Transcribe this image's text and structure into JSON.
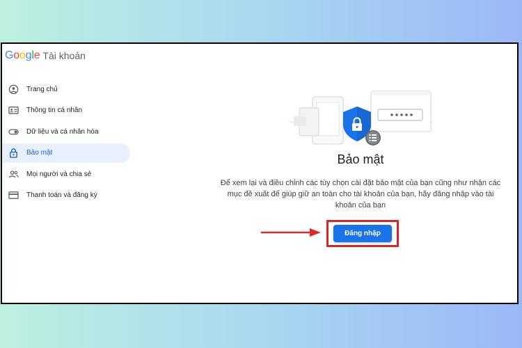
{
  "header": {
    "logo_letters": [
      {
        "ch": "G",
        "color": "#4285F4"
      },
      {
        "ch": "o",
        "color": "#EA4335"
      },
      {
        "ch": "o",
        "color": "#FBBC05"
      },
      {
        "ch": "g",
        "color": "#4285F4"
      },
      {
        "ch": "l",
        "color": "#34A853"
      },
      {
        "ch": "e",
        "color": "#EA4335"
      }
    ],
    "title": "Tài khoản"
  },
  "sidebar": {
    "items": [
      {
        "label": "Trang chủ",
        "icon": "home-icon"
      },
      {
        "label": "Thông tin cá nhân",
        "icon": "id-card-icon"
      },
      {
        "label": "Dữ liệu và cá nhân hóa",
        "icon": "toggle-icon"
      },
      {
        "label": "Bảo mật",
        "icon": "lock-icon",
        "active": true
      },
      {
        "label": "Mọi người và chia sẻ",
        "icon": "people-icon"
      },
      {
        "label": "Thanh toán và đăng ký",
        "icon": "card-icon"
      }
    ]
  },
  "main": {
    "title": "Bảo mật",
    "description_lines": [
      "Để xem lại và điều chỉnh các tùy chọn cài đặt bảo mật của bạn cũng như nhận các",
      "mục đề xuất để giúp giữ an toàn cho tài khoản của bạn, hãy đăng nhập vào tài",
      "khoản của bạn"
    ],
    "login_button": "Đăng nhập",
    "illustration": "security-shield-illustration"
  },
  "colors": {
    "accent": "#1a73e8",
    "active_bg": "#e8f0fe",
    "highlight": "#d6262a"
  }
}
